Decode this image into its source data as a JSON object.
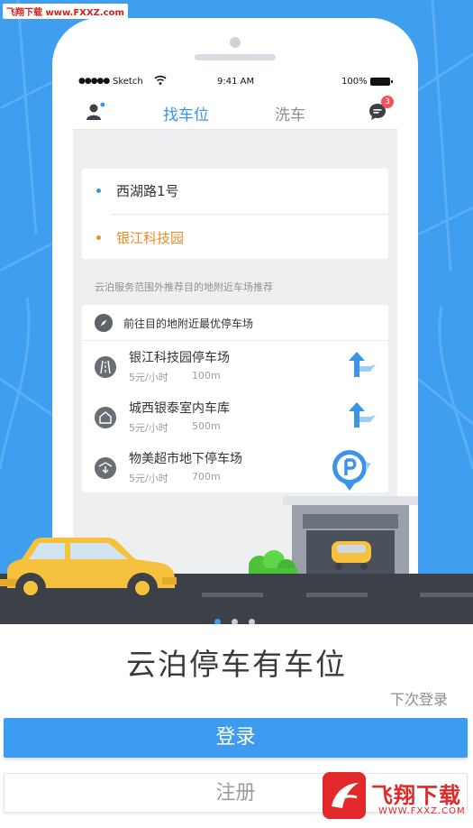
{
  "watermark": {
    "top_text": "飞翔下载 www.FXXZ.com",
    "logo_zh": "飞翔下载",
    "logo_en": "WWW.FXXZ.COM"
  },
  "status_bar": {
    "signal": "●●●●●",
    "carrier": "Sketch",
    "time": "9:41 AM",
    "battery": "100%"
  },
  "nav": {
    "tabs": [
      {
        "label": "找车位",
        "active": true
      },
      {
        "label": "洗车",
        "active": false
      }
    ],
    "message_badge": "3"
  },
  "route": {
    "origin": "西湖路1号",
    "destination": "银江科技园",
    "origin_color": "#3b94e8",
    "destination_color": "#f08a24"
  },
  "hint_text": "云泊服务范围外推荐目的地附近车场推荐",
  "parking": {
    "header": "前往目的地附近最优停车场",
    "lots": [
      {
        "name": "银江科技园停车场",
        "price": "5元/小时",
        "distance": "100m"
      },
      {
        "name": "城西银泰室内车库",
        "price": "5元/小时",
        "distance": "500m"
      },
      {
        "name": "物美超市地下停车场",
        "price": "5元/小时",
        "distance": "700m"
      }
    ]
  },
  "pagination": {
    "count": 3,
    "active_index": 0
  },
  "app_title": "云泊停车有车位",
  "skip_login": "下次登录",
  "login_button": "登录",
  "register_button": "注册",
  "colors": {
    "primary": "#3d9bf0",
    "hero_bg": "#3f9ef0",
    "car": "#f6c23e",
    "road": "#3c4047"
  }
}
